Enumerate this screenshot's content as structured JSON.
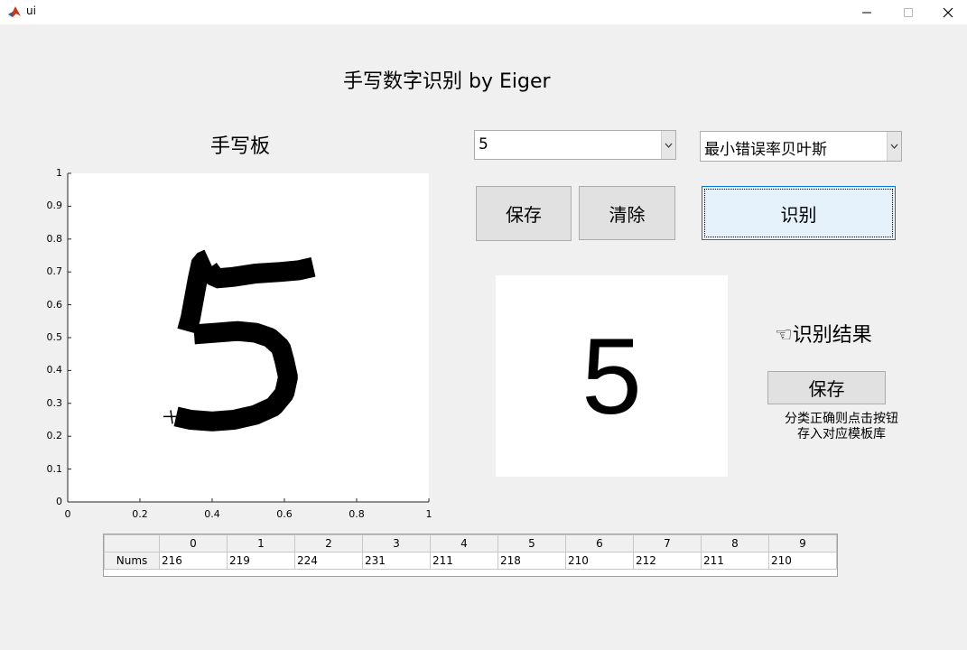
{
  "window": {
    "title": "ui",
    "icon": "matlab-icon",
    "controls": [
      "minimize-icon",
      "maximize-icon",
      "close-icon"
    ]
  },
  "main_title": "手写数字识别 by Eiger",
  "pad_label": "手写板",
  "digit_select": {
    "value": "5"
  },
  "method_select": {
    "value": "最小错误率贝叶斯"
  },
  "buttons": {
    "save": "保存",
    "clear": "清除",
    "recognize": "识别",
    "save_template": "保存"
  },
  "result": {
    "digit": "5",
    "label": "☜识别结果"
  },
  "hint": {
    "line1": "分类正确则点击按钮",
    "line2": "存入对应模板库"
  },
  "axes": {
    "x_ticks": [
      "0",
      "0.2",
      "0.4",
      "0.6",
      "0.8",
      "1"
    ],
    "y_ticks": [
      "1",
      "0.9",
      "0.8",
      "0.7",
      "0.6",
      "0.5",
      "0.4",
      "0.3",
      "0.2",
      "0.1",
      "0"
    ],
    "xlim": [
      0,
      1
    ],
    "ylim": [
      0,
      1
    ]
  },
  "stroke_points": [
    [
      0.39,
      0.74
    ],
    [
      0.37,
      0.73
    ],
    [
      0.36,
      0.68
    ],
    [
      0.35,
      0.62
    ],
    [
      0.34,
      0.56
    ],
    [
      0.33,
      0.52
    ],
    [
      0.39,
      0.71
    ],
    [
      0.41,
      0.68
    ],
    [
      0.46,
      0.685
    ],
    [
      0.52,
      0.695
    ],
    [
      0.59,
      0.7
    ],
    [
      0.64,
      0.705
    ],
    [
      0.68,
      0.715
    ],
    [
      0.35,
      0.51
    ],
    [
      0.41,
      0.515
    ],
    [
      0.47,
      0.52
    ],
    [
      0.52,
      0.515
    ],
    [
      0.56,
      0.5
    ],
    [
      0.59,
      0.47
    ],
    [
      0.6,
      0.43
    ],
    [
      0.61,
      0.38
    ],
    [
      0.6,
      0.33
    ],
    [
      0.57,
      0.29
    ],
    [
      0.52,
      0.265
    ],
    [
      0.46,
      0.25
    ],
    [
      0.4,
      0.245
    ],
    [
      0.34,
      0.25
    ],
    [
      0.3,
      0.26
    ]
  ],
  "table": {
    "columns": [
      "0",
      "1",
      "2",
      "3",
      "4",
      "5",
      "6",
      "7",
      "8",
      "9"
    ],
    "row_label": "Nums",
    "values": [
      "216",
      "219",
      "224",
      "231",
      "211",
      "218",
      "210",
      "212",
      "211",
      "210"
    ]
  }
}
